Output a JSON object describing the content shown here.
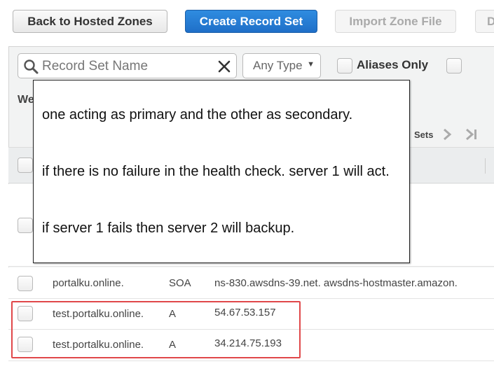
{
  "toolbar": {
    "back_label": "Back to Hosted Zones",
    "create_label": "Create Record Set",
    "import_label": "Import Zone File",
    "partial_label": "D"
  },
  "filter": {
    "search_placeholder": "Record Set Name",
    "type_selected": "Any Type",
    "aliases_label": "Aliases Only"
  },
  "partial_labels": {
    "weighted_fragment": "We",
    "pager_sets": "Sets"
  },
  "tooltip": {
    "line1": "one acting as primary and the other as secondary.",
    "line2": "if there is no failure in the health check. server 1 will act.",
    "line3": "if server 1 fails then server 2 will backup."
  },
  "records": [
    {
      "name": "portalku.online.",
      "type": "SOA",
      "value": "ns-830.awsdns-39.net. awsdns-hostmaster.amazon."
    },
    {
      "name": "test.portalku.online.",
      "type": "A",
      "value": "54.67.53.157"
    },
    {
      "name": "test.portalku.online.",
      "type": "A",
      "value": "34.214.75.193"
    }
  ],
  "colors": {
    "primary_button": "#1f6fc8",
    "highlight_border": "#e0484a",
    "panel_bg": "#f2f3f3"
  }
}
